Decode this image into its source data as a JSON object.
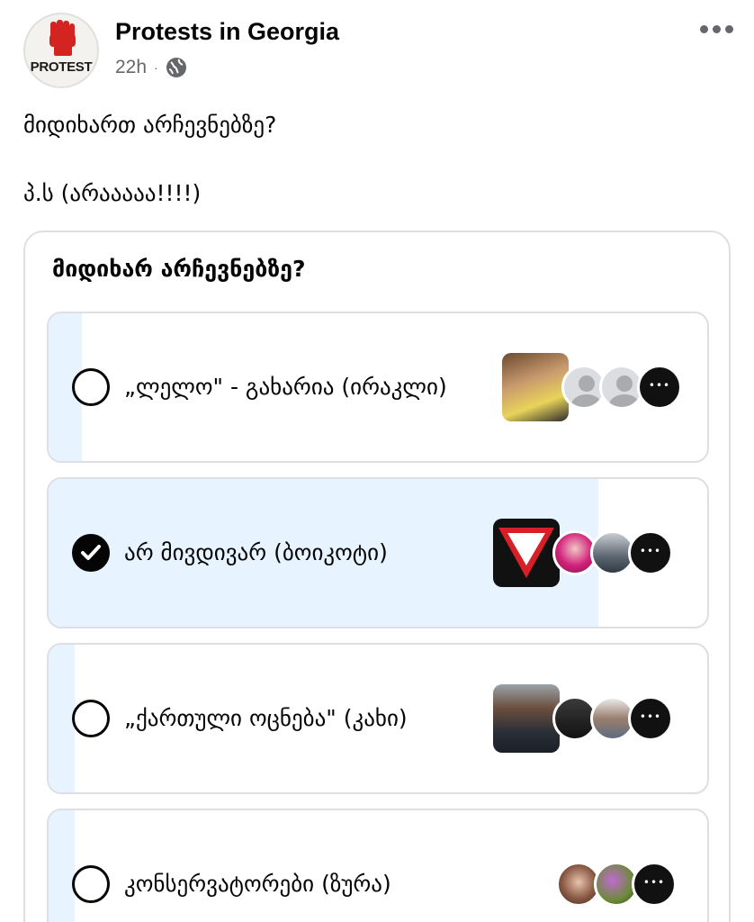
{
  "page": {
    "name": "Protests in Georgia",
    "logo_text": "PROTEST",
    "time": "22h",
    "audience_icon": "globe-icon",
    "more_icon": "more-dots-icon"
  },
  "post": {
    "line1": "მიდიხართ არჩევნებზე?",
    "line2": "პ.ს  (არააააა!!!!)"
  },
  "poll": {
    "question": "მიდიხარ არჩევნებზე?",
    "options": [
      {
        "label": "„ლელო\" - გახარია (ირაკლი)",
        "selected": false,
        "vote_fraction": 0.05
      },
      {
        "label": "არ მივდივარ (ბოიკოტი)",
        "selected": true,
        "vote_fraction": 0.835
      },
      {
        "label": "„ქართული ოცნება\" (კახი)",
        "selected": false,
        "vote_fraction": 0.04
      },
      {
        "label": "კონსერვატორები (ზურა)",
        "selected": false,
        "vote_fraction": 0.04
      }
    ],
    "accent_fill": "#e7f3ff"
  }
}
